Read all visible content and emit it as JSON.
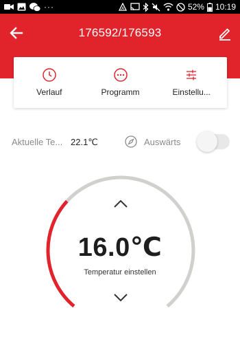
{
  "status_bar": {
    "dots": "···",
    "battery": "52%",
    "time": "10:19"
  },
  "app_bar": {
    "title": "176592/176593",
    "back_icon": "arrow-left-icon",
    "edit_icon": "pencil-icon"
  },
  "tabs": [
    {
      "label": "Verlauf",
      "icon": "clock-icon"
    },
    {
      "label": "Programm",
      "icon": "dots-circle-icon"
    },
    {
      "label": "Einstellu...",
      "icon": "sliders-icon"
    }
  ],
  "current_temp": {
    "label": "Aktuelle Te...",
    "value": "22.1℃"
  },
  "away": {
    "label": "Auswärts",
    "icon": "compass-icon",
    "enabled": false
  },
  "dial": {
    "value": "16.0℃",
    "caption": "Temperatur einstellen",
    "setpoint_fraction": 0.33
  },
  "colors": {
    "accent": "#e1232b",
    "arc_track": "#d0d0cc"
  }
}
